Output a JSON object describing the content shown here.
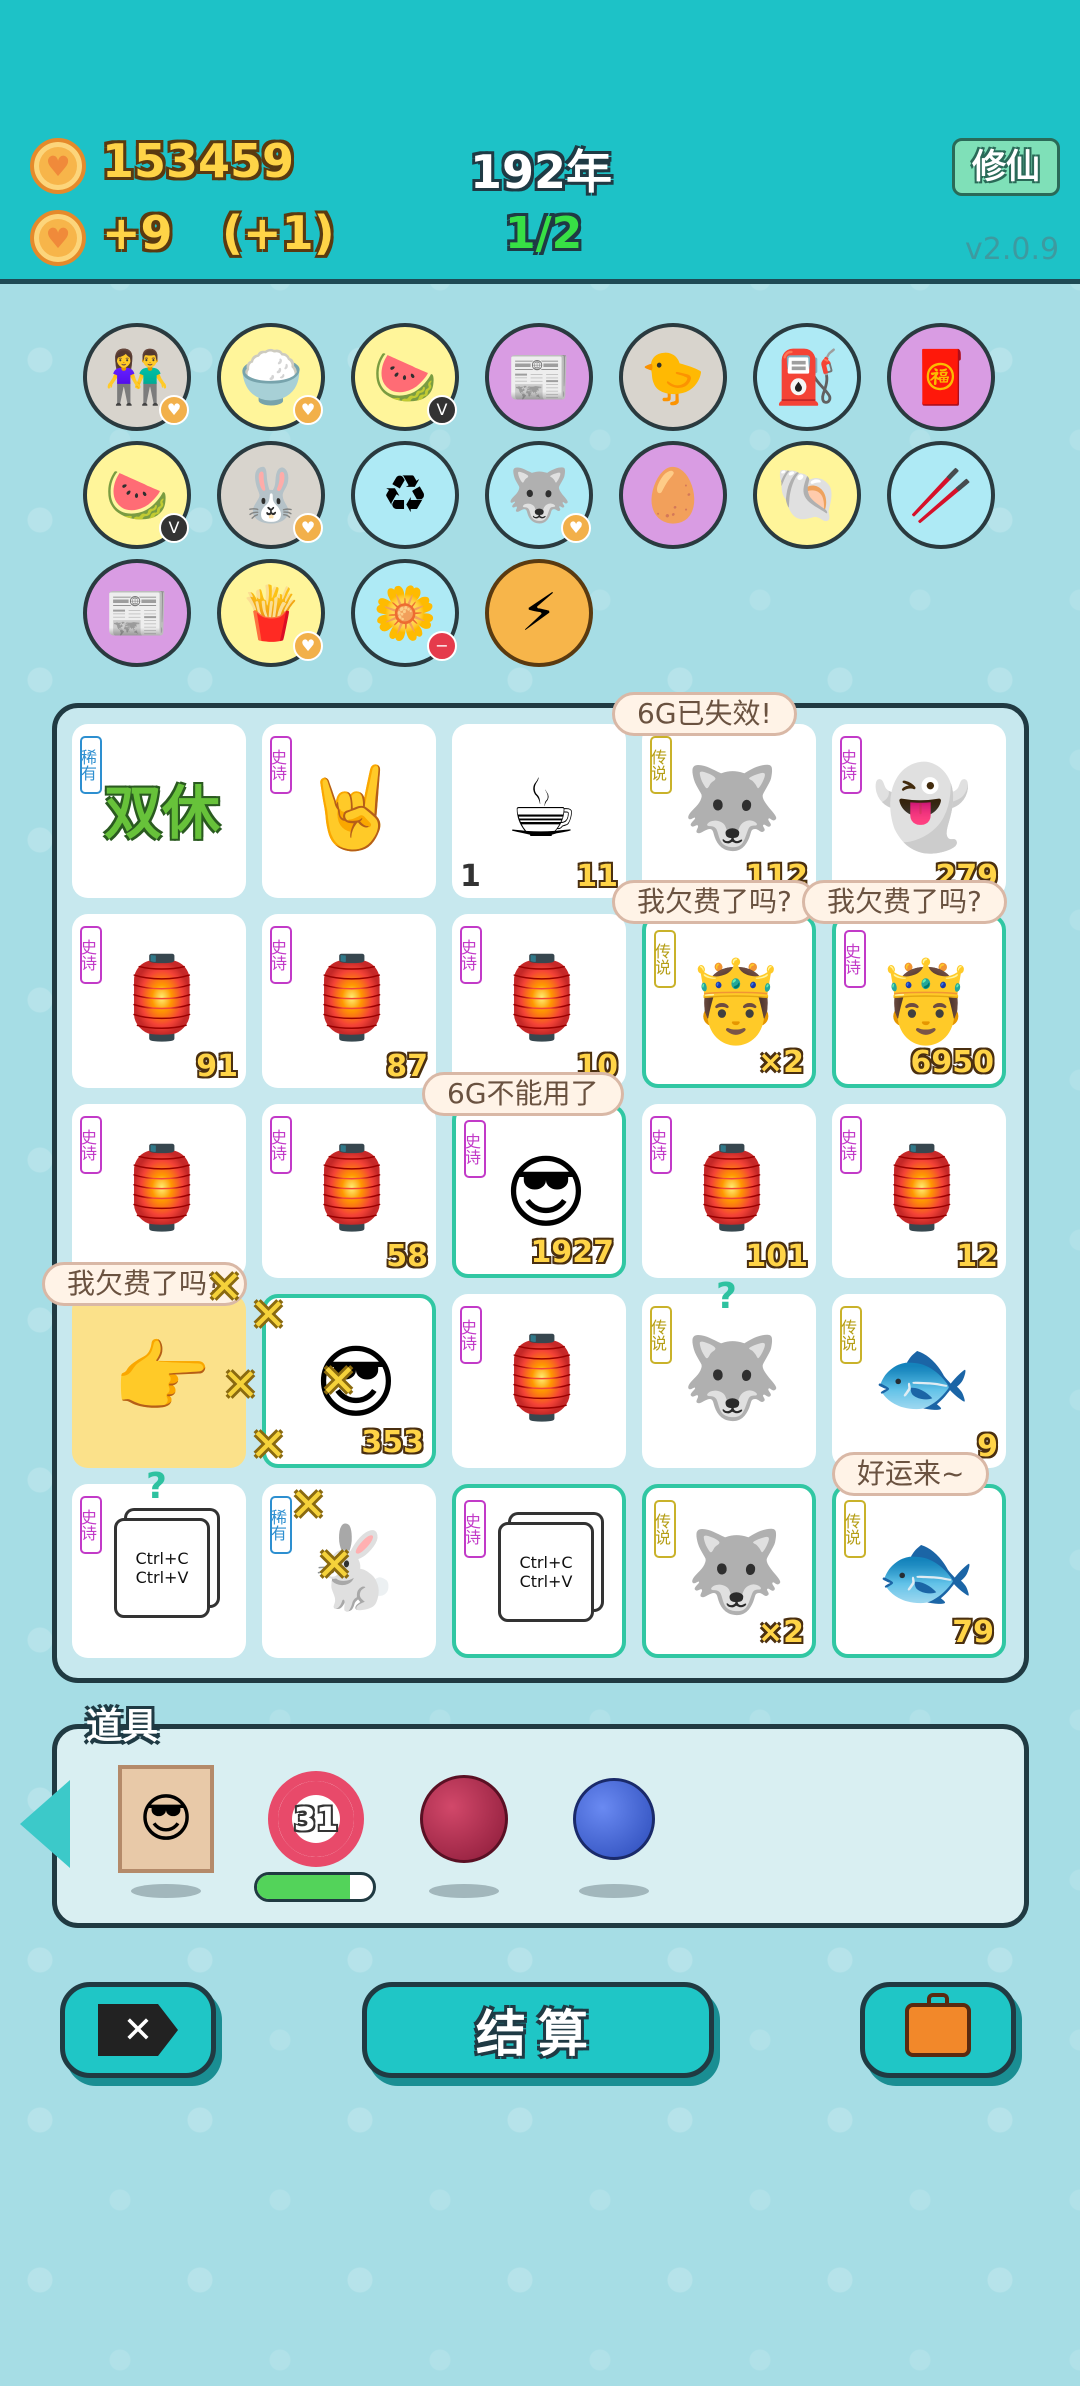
{
  "header": {
    "coins": "153459",
    "income": "+9",
    "income_bonus": "(+1)",
    "year": "192年",
    "round": "1/2",
    "xiuxian_label": "修仙",
    "version": "v2.0.9"
  },
  "collection": [
    {
      "icon": "couple-icon",
      "glyph": "👫",
      "color": "gray",
      "badge": "coin"
    },
    {
      "icon": "rice-bowl-icon",
      "glyph": "🍚",
      "color": "yellow",
      "badge": "coin"
    },
    {
      "icon": "fruit-basket-icon",
      "glyph": "🍉",
      "color": "yellow",
      "badge": "v"
    },
    {
      "icon": "time-magazine-icon",
      "glyph": "📰",
      "color": "purple",
      "badge": ""
    },
    {
      "icon": "chick-egg-icon",
      "glyph": "🐤",
      "color": "gray",
      "badge": ""
    },
    {
      "icon": "pump-icon",
      "glyph": "⛽",
      "color": "blue",
      "badge": ""
    },
    {
      "icon": "red-envelope-icon",
      "glyph": "🧧",
      "color": "purple",
      "badge": ""
    },
    {
      "icon": "fruit-basket-icon",
      "glyph": "🍉",
      "color": "yellow",
      "badge": "v"
    },
    {
      "icon": "rabbit-icon",
      "glyph": "🐰",
      "color": "gray",
      "badge": "coin"
    },
    {
      "icon": "recycle-bag-icon",
      "glyph": "♻",
      "color": "blue",
      "badge": ""
    },
    {
      "icon": "husky-icon",
      "glyph": "🐺",
      "color": "blue",
      "badge": "coin"
    },
    {
      "icon": "egg-icon",
      "glyph": "🥚",
      "color": "purple",
      "badge": ""
    },
    {
      "icon": "shell-icon",
      "glyph": "🐚",
      "color": "yellow",
      "badge": ""
    },
    {
      "icon": "chopsticks-icon",
      "glyph": "🥢",
      "color": "blue",
      "badge": ""
    },
    {
      "icon": "time-magazine-icon",
      "glyph": "📰",
      "color": "purple",
      "badge": ""
    },
    {
      "icon": "fries-icon",
      "glyph": "🍟",
      "color": "yellow",
      "badge": "coin"
    },
    {
      "icon": "flower-pot-icon",
      "glyph": "🌼",
      "color": "blue",
      "badge": "minus"
    },
    {
      "icon": "lightning-icon",
      "glyph": "⚡",
      "color": "gold",
      "badge": ""
    }
  ],
  "board": [
    {
      "icon": "shuangxiu-text-icon",
      "text": "双休",
      "rarity": "稀有",
      "rarity_type": "rare",
      "value": "",
      "left": "",
      "glow": false
    },
    {
      "icon": "rock-hand-icon",
      "glyph": "🤘",
      "rarity": "史诗",
      "rarity_type": "epic",
      "value": "",
      "left": "",
      "glow": false
    },
    {
      "icon": "coffee-cup-icon",
      "glyph": "☕",
      "rarity": "",
      "rarity_type": "",
      "value": "11",
      "left": "1",
      "glow": false
    },
    {
      "icon": "husky-icon",
      "glyph": "🐺",
      "rarity": "传说",
      "rarity_type": "legend",
      "value": "112",
      "left": "",
      "glow": false
    },
    {
      "icon": "ghost-icon",
      "glyph": "👻",
      "rarity": "史诗",
      "rarity_type": "epic",
      "value": "279",
      "left": "",
      "glow": false
    },
    {
      "icon": "rabbit-house-icon",
      "glyph": "🏮",
      "rarity": "史诗",
      "rarity_type": "epic",
      "value": "91",
      "left": "",
      "glow": false
    },
    {
      "icon": "rabbit-house-icon",
      "glyph": "🏮",
      "rarity": "史诗",
      "rarity_type": "epic",
      "value": "87",
      "left": "",
      "glow": false
    },
    {
      "icon": "rabbit-house-icon",
      "glyph": "🏮",
      "rarity": "史诗",
      "rarity_type": "epic",
      "value": "10",
      "left": "",
      "glow": false
    },
    {
      "icon": "king-old-man-icon",
      "glyph": "🤴",
      "rarity": "传说",
      "rarity_type": "legend",
      "value": "×2",
      "left": "",
      "glow": true
    },
    {
      "icon": "king-green-hair-icon",
      "glyph": "🤴",
      "rarity": "史诗",
      "rarity_type": "epic",
      "value": "6950",
      "left": "",
      "glow": true
    },
    {
      "icon": "rabbit-house-icon",
      "glyph": "🏮",
      "rarity": "史诗",
      "rarity_type": "epic",
      "value": "",
      "left": "",
      "glow": false
    },
    {
      "icon": "rabbit-house-icon",
      "glyph": "🏮",
      "rarity": "史诗",
      "rarity_type": "epic",
      "value": "58",
      "left": "",
      "glow": false
    },
    {
      "icon": "green-hair-man-icon",
      "glyph": "😎",
      "rarity": "史诗",
      "rarity_type": "epic",
      "value": "1927",
      "left": "",
      "glow": true
    },
    {
      "icon": "rabbit-house-icon",
      "glyph": "🏮",
      "rarity": "史诗",
      "rarity_type": "epic",
      "value": "101",
      "left": "",
      "glow": false
    },
    {
      "icon": "rabbit-house-icon",
      "glyph": "🏮",
      "rarity": "史诗",
      "rarity_type": "epic",
      "value": "12",
      "left": "",
      "glow": false
    },
    {
      "icon": "pointing-hand-icon",
      "glyph": "👉",
      "rarity": "",
      "rarity_type": "",
      "value": "",
      "left": "",
      "glow": false,
      "gold": true
    },
    {
      "icon": "green-hair-man-icon",
      "glyph": "😎",
      "rarity": "",
      "rarity_type": "",
      "value": "353",
      "left": "",
      "glow": true
    },
    {
      "icon": "rabbit-house-icon",
      "glyph": "🏮",
      "rarity": "史诗",
      "rarity_type": "epic",
      "value": "",
      "left": "",
      "glow": false
    },
    {
      "icon": "king-husky-icon",
      "glyph": "🐺",
      "rarity": "传说",
      "rarity_type": "legend",
      "value": "",
      "left": "",
      "glow": false
    },
    {
      "icon": "koi-fish-icon",
      "glyph": "🐟",
      "rarity": "传说",
      "rarity_type": "legend",
      "value": "9",
      "left": "",
      "glow": false
    },
    {
      "icon": "ctrl-cv-icon",
      "text": "Ctrl+C Ctrl+V",
      "rarity": "史诗",
      "rarity_type": "epic",
      "value": "",
      "left": "",
      "glow": false
    },
    {
      "icon": "rabbit-lantern-icon",
      "glyph": "🐇",
      "rarity": "稀有",
      "rarity_type": "rare",
      "value": "",
      "left": "",
      "glow": false
    },
    {
      "icon": "ctrl-cv-icon",
      "text": "Ctrl+C Ctrl+V",
      "rarity": "史诗",
      "rarity_type": "epic",
      "value": "",
      "left": "",
      "glow": true
    },
    {
      "icon": "king-husky-icon",
      "glyph": "🐺",
      "rarity": "传说",
      "rarity_type": "legend",
      "value": "×2",
      "left": "",
      "glow": true
    },
    {
      "icon": "koi-fish-icon",
      "glyph": "🐟",
      "rarity": "传说",
      "rarity_type": "legend",
      "value": "79",
      "left": "",
      "glow": true
    }
  ],
  "bubbles": {
    "b1": "6G已失效!",
    "b2": "我欠费了吗?",
    "b3": "我欠费了吗?",
    "b4": "6G不能用了",
    "b5": "我欠费了吗?",
    "b6": "好运来~"
  },
  "items": {
    "label": "道具",
    "ring_count": "31",
    "ring_progress": 0.8
  },
  "buttons": {
    "settle": "结算"
  },
  "colors": {
    "topbar": "#1dc2c7",
    "accent": "#1fc6c6",
    "coin_text": "#ffd447",
    "round_text": "#37e045"
  }
}
